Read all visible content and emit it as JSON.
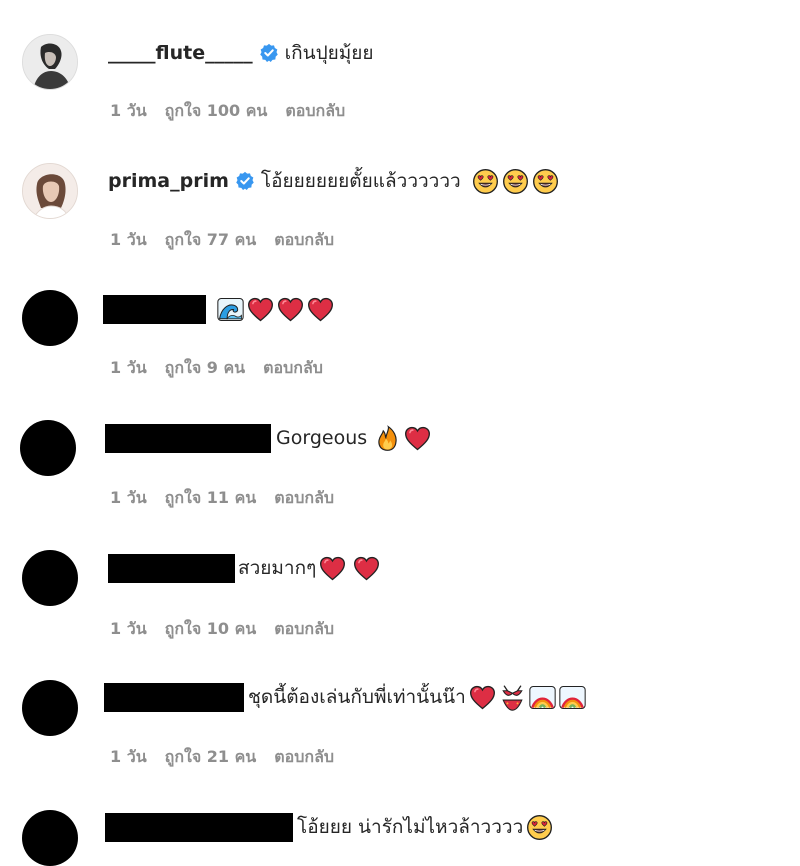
{
  "comments": [
    {
      "username": "_____flute_____",
      "verified": true,
      "text": "เกินปุยมุ้ยย",
      "time": "1 วัน",
      "likes": "ถูกใจ 100 คน",
      "reply": "ตอบกลับ"
    },
    {
      "username": "prima_prim",
      "verified": true,
      "text": "โอ้ยยยยยยตั้ยแล้วววววว",
      "time": "1 วัน",
      "likes": "ถูกใจ 77 คน",
      "reply": "ตอบกลับ"
    },
    {
      "text": "",
      "time": "1 วัน",
      "likes": "ถูกใจ 9 คน",
      "reply": "ตอบกลับ"
    },
    {
      "text": "Gorgeous",
      "time": "1 วัน",
      "likes": "ถูกใจ 11 คน",
      "reply": "ตอบกลับ"
    },
    {
      "text": "สวยมากๆ",
      "time": "1 วัน",
      "likes": "ถูกใจ 10 คน",
      "reply": "ตอบกลับ"
    },
    {
      "text": "ชุดนี้ต้องเล่นกับพี่เท่านั้นน๊า",
      "time": "1 วัน",
      "likes": "ถูกใจ 21 คน",
      "reply": "ตอบกลับ"
    },
    {
      "text": "โอ้ยยย น่ารักไม่ไหวล้าวววว"
    }
  ],
  "icons": {
    "verified_color": "#3897f0",
    "heart": "red-heart-icon",
    "heart_eyes": "heart-eyes-emoji-icon",
    "wave": "wave-emoji-icon",
    "fire": "fire-emoji-icon",
    "bikini": "bikini-emoji-icon",
    "rainbow": "rainbow-emoji-icon"
  }
}
